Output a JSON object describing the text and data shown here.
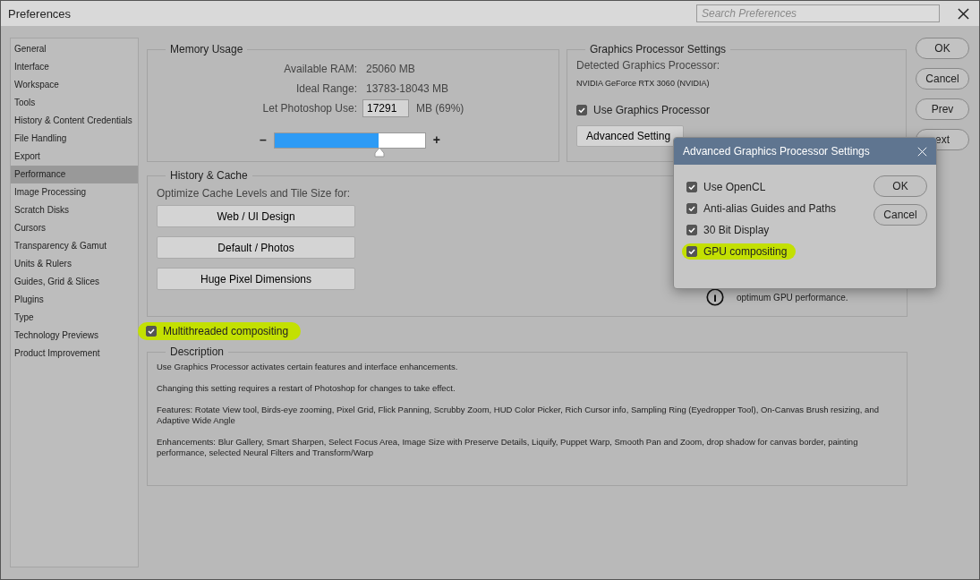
{
  "window": {
    "title": "Preferences"
  },
  "search": {
    "placeholder": "Search Preferences"
  },
  "sidebar": {
    "items": [
      {
        "label": "General",
        "selected": false
      },
      {
        "label": "Interface",
        "selected": false
      },
      {
        "label": "Workspace",
        "selected": false
      },
      {
        "label": "Tools",
        "selected": false
      },
      {
        "label": "History & Content Credentials",
        "selected": false
      },
      {
        "label": "File Handling",
        "selected": false
      },
      {
        "label": "Export",
        "selected": false
      },
      {
        "label": "Performance",
        "selected": true
      },
      {
        "label": "Image Processing",
        "selected": false
      },
      {
        "label": "Scratch Disks",
        "selected": false
      },
      {
        "label": "Cursors",
        "selected": false
      },
      {
        "label": "Transparency & Gamut",
        "selected": false
      },
      {
        "label": "Units & Rulers",
        "selected": false
      },
      {
        "label": "Guides, Grid & Slices",
        "selected": false
      },
      {
        "label": "Plugins",
        "selected": false
      },
      {
        "label": "Type",
        "selected": false
      },
      {
        "label": "Technology Previews",
        "selected": false
      },
      {
        "label": "Product Improvement",
        "selected": false
      }
    ]
  },
  "memory_usage": {
    "title": "Memory Usage",
    "rows": [
      {
        "label": "Available RAM:",
        "value": "25060 MB"
      },
      {
        "label": "Ideal Range:",
        "value": "13783-18043 MB"
      }
    ],
    "use_label": "Let Photoshop Use:",
    "use_value": "17291",
    "use_suffix": "MB (69%)",
    "minus": "–",
    "plus": "+",
    "level": 0.69
  },
  "graphics": {
    "title": "Graphics Processor Settings",
    "detected_label": "Detected Graphics Processor:",
    "processor": "NVIDIA GeForce RTX 3060 (NVIDIA)",
    "use_gpu": {
      "label": "Use Graphics Processor",
      "checked": true
    },
    "advanced_button": "Advanced Setting"
  },
  "history_cache": {
    "title": "History & Cache",
    "prompt": "Optimize Cache Levels and Tile Size for:",
    "buttons": [
      "Web / UI Design",
      "Default / Photos",
      "Huge Pixel Dimensions"
    ],
    "hint": "optimum GPU performance."
  },
  "multithreaded": {
    "label": "Multithreaded compositing",
    "checked": true,
    "highlighted": true
  },
  "description": {
    "title": "Description",
    "paragraphs": [
      "Use Graphics Processor activates certain features and interface enhancements.",
      "Changing this setting requires a restart of Photoshop for changes to take effect.",
      "Features: Rotate View tool, Birds-eye zooming, Pixel Grid, Flick Panning, Scrubby Zoom, HUD Color Picker, Rich Cursor info, Sampling Ring (Eyedropper Tool), On-Canvas Brush resizing, and Adaptive Wide Angle",
      "Enhancements: Blur Gallery, Smart Sharpen, Select Focus Area, Image Size with Preserve Details, Liquify, Puppet Warp, Smooth Pan and Zoom, drop shadow for canvas border, painting performance, selected Neural Filters and Transform/Warp"
    ]
  },
  "buttons": [
    "OK",
    "Cancel",
    "Prev",
    "ext"
  ],
  "advanced_dialog": {
    "title": "Advanced Graphics Processor Settings",
    "options": [
      {
        "label": "Use OpenCL",
        "checked": true,
        "highlighted": false
      },
      {
        "label": "Anti-alias Guides and Paths",
        "checked": true,
        "highlighted": false
      },
      {
        "label": "30 Bit Display",
        "checked": true,
        "highlighted": false
      },
      {
        "label": "GPU compositing",
        "checked": true,
        "highlighted": true
      }
    ],
    "buttons": [
      "OK",
      "Cancel"
    ]
  }
}
